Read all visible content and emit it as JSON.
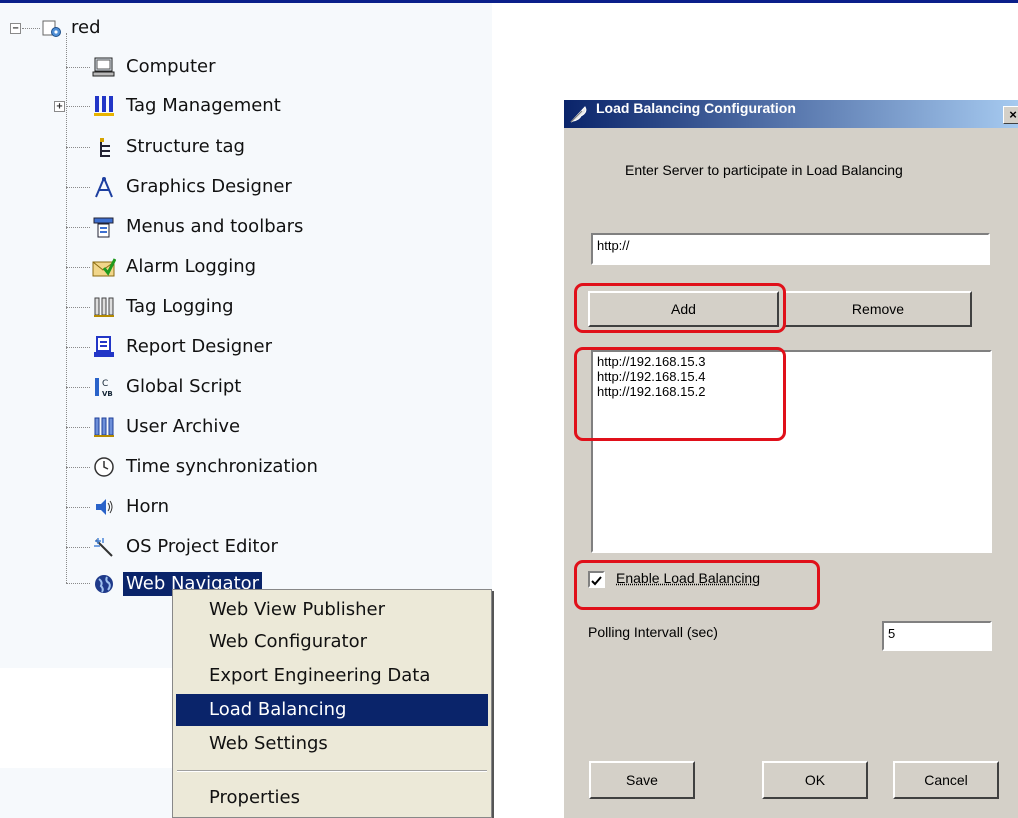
{
  "tree": {
    "root_label": "red",
    "items": [
      {
        "label": "Computer",
        "icon": "computer-icon"
      },
      {
        "label": "Tag Management",
        "icon": "tag-management-icon"
      },
      {
        "label": "Structure tag",
        "icon": "structure-tag-icon"
      },
      {
        "label": "Graphics Designer",
        "icon": "graphics-designer-icon"
      },
      {
        "label": "Menus and toolbars",
        "icon": "menus-toolbars-icon"
      },
      {
        "label": "Alarm Logging",
        "icon": "alarm-logging-icon"
      },
      {
        "label": "Tag Logging",
        "icon": "tag-logging-icon"
      },
      {
        "label": "Report Designer",
        "icon": "report-designer-icon"
      },
      {
        "label": "Global Script",
        "icon": "global-script-icon"
      },
      {
        "label": "User Archive",
        "icon": "user-archive-icon"
      },
      {
        "label": "Time synchronization",
        "icon": "clock-icon"
      },
      {
        "label": "Horn",
        "icon": "horn-icon"
      },
      {
        "label": "OS Project Editor",
        "icon": "project-editor-icon"
      },
      {
        "label": "Web Navigator",
        "icon": "globe-icon"
      }
    ]
  },
  "context_menu": {
    "items": [
      "Web View Publisher",
      "Web Configurator",
      "Export Engineering Data",
      "Load Balancing",
      "Web Settings"
    ],
    "highlighted": "Load Balancing",
    "properties": "Properties"
  },
  "dialog": {
    "title": "Load Balancing Configuration",
    "close_glyph": "×",
    "instruction": "Enter Server to participate in Load Balancing",
    "url_input": "http://",
    "add_label": "Add",
    "remove_label": "Remove",
    "servers": [
      "http://192.168.15.3",
      "http://192.168.15.4",
      "http://192.168.15.2"
    ],
    "enable_label": "Enable Load Balancing",
    "enable_checked": true,
    "polling_label": "Polling Intervall (sec)",
    "polling_value": "5",
    "save_label": "Save",
    "ok_label": "OK",
    "cancel_label": "Cancel"
  },
  "colors": {
    "highlight": "#0a246a",
    "annotation_red": "#e0101a",
    "dialog_face": "#d4d0c8",
    "tree_background": "#f6f9fc"
  }
}
